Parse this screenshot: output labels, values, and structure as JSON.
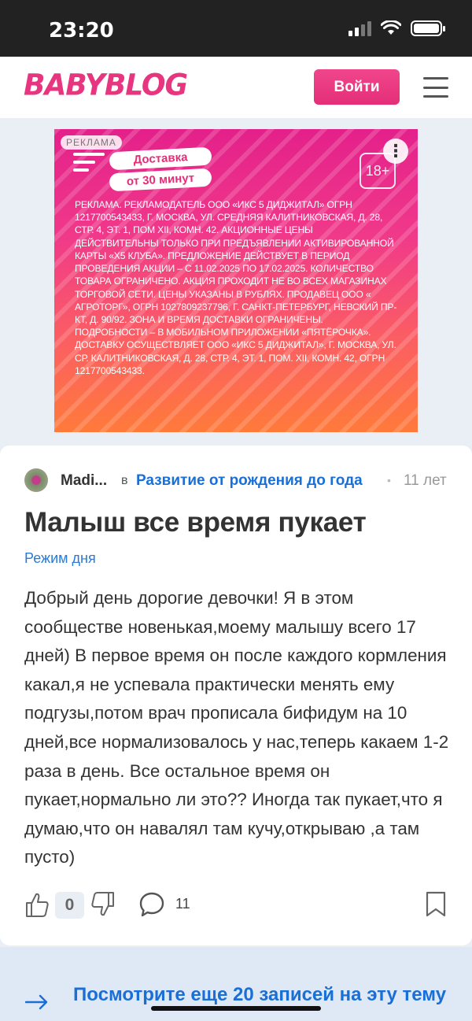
{
  "status_bar": {
    "time": "23:20"
  },
  "header": {
    "logo": "BABYBLOG",
    "login_label": "Войти"
  },
  "ad": {
    "label": "РЕКЛАМА",
    "delivery_line1": "Доставка",
    "delivery_line2": "от 30 минут",
    "age": "18+",
    "more_glyph": "⋮",
    "text": "Реклама. Рекламодатель ООО «ИКС 5 Диджитал» ОГРН 1217700543433, г. Москва, ул. Средняя Калитниковская, д. 28, стр. 4, эт. 1, пом XII, комн. 42. Акционные цены действительны только при предъявлении активированной карты «X5 Клуба». Предложение действует в период проведения акции – с 11.02.2025 по 17.02.2025. Количество товара ограничено. Акция проходит не во всех магазинах торговой сети. Цены указаны в рублях. Продавец ООО « Агроторг», ОГРН 1027809237796, г. Санкт-Петербург, Невский пр-кт, д. 90/92. Зона и время доставки ограничены. Подробности – в мобильном приложении «Пятёрочка». Доставку осуществляет ООО «ИКС 5 Диджитал», г. Москва, ул. Ср. Калитниковская, д. 28, стр. 4, эт. 1, пом. XII, комн. 42, ОГРН 1217700543433."
  },
  "post": {
    "author": "Madi...",
    "in_word": "в",
    "community": "Развитие от рождения до года",
    "dot": "•",
    "time_ago": "11 лет",
    "title": "Малыш все время пукает",
    "tag": "Режим дня",
    "body": "Добрый день дорогие девочки! Я в этом сообществе новенькая,моему малышу всего 17 дней) В первое время он после каждого кормления какал,я не успевала практически менять ему подгузы,потом врач прописала бифидум на 10 дней,все нормализовалось у нас,теперь какаем 1-2 раза в день. Все остальное время он пукает,нормально ли это?? Иногда так пукает,что я думаю,что он навалял там кучу,открываю ,а там пусто)",
    "likes": "0",
    "comments": "11"
  },
  "more": {
    "text": "Посмотрите еще 20 записей на эту тему"
  },
  "colors": {
    "brand": "#e8357f",
    "link": "#1a6fd6"
  }
}
